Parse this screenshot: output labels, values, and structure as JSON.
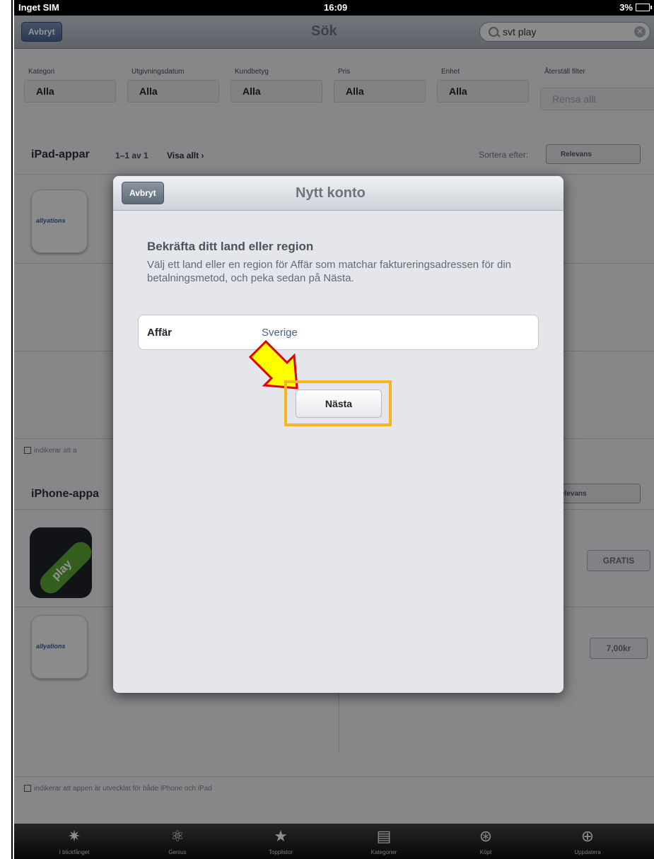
{
  "status_bar": {
    "carrier": "Inget SIM",
    "time": "16:09",
    "battery": "3%"
  },
  "nav": {
    "cancel_label": "Avbryt",
    "title": "Sök",
    "search_value": "svt play"
  },
  "filters": [
    {
      "label": "Kategori",
      "value": "Alla"
    },
    {
      "label": "Utgivningsdatum",
      "value": "Alla"
    },
    {
      "label": "Kundbetyg",
      "value": "Alla"
    },
    {
      "label": "Pris",
      "value": "Alla"
    },
    {
      "label": "Enhet",
      "value": "Alla"
    },
    {
      "label": "Återställ filter",
      "value": "Rensa allt"
    }
  ],
  "ipad_section": {
    "title": "iPad-appar",
    "count": "1–1 av 1",
    "show_all": "Visa allt ›",
    "sort_label": "Sortera efter:",
    "sort_value": "Relevans"
  },
  "iphone_section": {
    "title": "iPhone-appa",
    "sort_value": "elevans"
  },
  "notes": {
    "first": "indikerar att a",
    "second": "indikerar att appen är utvecklat för både iPhone och iPad"
  },
  "prices": {
    "svt_play": "GRATIS",
    "second_app": "7,00kr"
  },
  "modal": {
    "cancel_label": "Avbryt",
    "title": "Nytt konto",
    "heading": "Bekräfta ditt land eller region",
    "description": "Välj ett land eller en region för Affär som matchar faktureringsadressen för din betalningsmetod, och peka sedan på Nästa.",
    "field_label": "Affär",
    "field_value": "Sverige",
    "next_label": "Nästa"
  },
  "tabs": [
    {
      "label": "I blickfånget",
      "icon": "spotlight-icon"
    },
    {
      "label": "Genius",
      "icon": "genius-icon"
    },
    {
      "label": "Topplistor",
      "icon": "star-icon"
    },
    {
      "label": "Kategorier",
      "icon": "categories-icon"
    },
    {
      "label": "Köpt",
      "icon": "purchased-icon"
    },
    {
      "label": "Uppdatera",
      "icon": "update-icon"
    }
  ],
  "colors": {
    "highlight": "#f6b521",
    "arrow_fill": "#ffff00",
    "arrow_stroke": "#e00000"
  }
}
